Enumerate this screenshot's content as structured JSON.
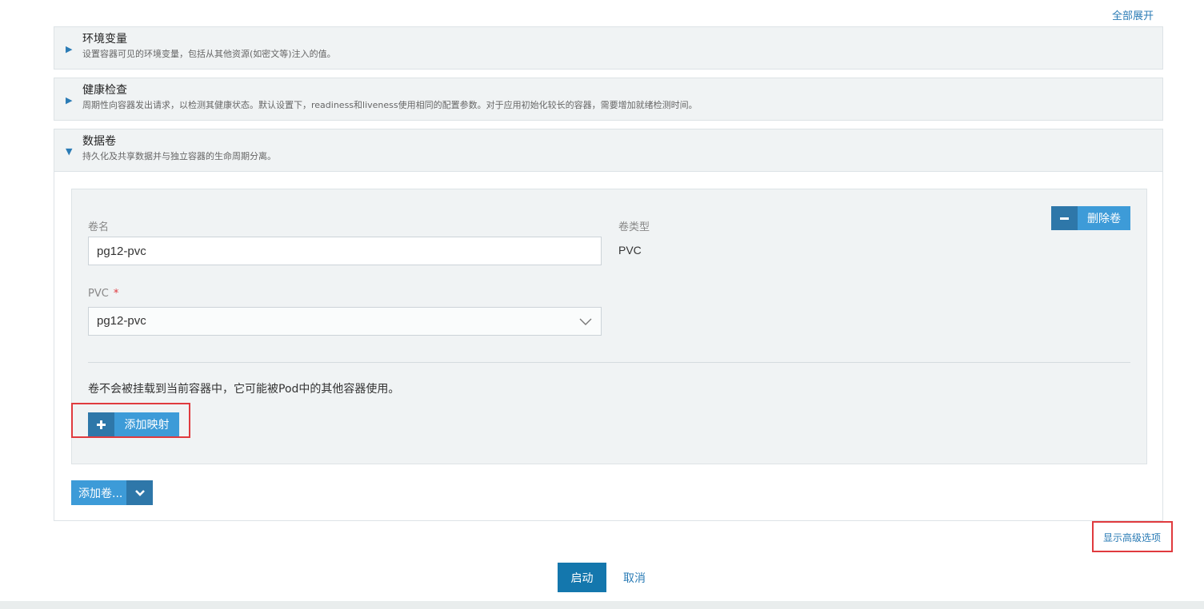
{
  "header": {
    "expand_all": "全部展开"
  },
  "sections": {
    "env": {
      "title": "环境变量",
      "desc": "设置容器可见的环境变量，包括从其他资源(如密文等)注入的值。"
    },
    "health": {
      "title": "健康检查",
      "desc": "周期性向容器发出请求，以检测其健康状态。默认设置下，readiness和liveness使用相同的配置参数。对于应用初始化较长的容器，需要增加就绪检测时间。"
    },
    "volumes": {
      "title": "数据卷",
      "desc": "持久化及共享数据并与独立容器的生命周期分离。"
    }
  },
  "volume_card": {
    "name_label": "卷名",
    "name_value": "pg12-pvc",
    "type_label": "卷类型",
    "type_value": "PVC",
    "pvc_label": "PVC",
    "pvc_required": "*",
    "pvc_value": "pg12-pvc",
    "delete_label": "删除卷",
    "hint": "卷不会被挂载到当前容器中，它可能被Pod中的其他容器使用。",
    "add_mapping_label": "添加映射"
  },
  "add_volume_label": "添加卷...",
  "advanced_link": "显示高级选项",
  "actions": {
    "start": "启动",
    "cancel": "取消"
  },
  "icons": {
    "collapsed": "triangle-right-icon",
    "expanded": "triangle-down-icon",
    "select": "chevron-down-icon",
    "delete": "minus-icon",
    "add": "plus-icon"
  },
  "colors": {
    "accent": "#3d9bd8",
    "accent_dark": "#2e77a9",
    "primary_button": "#1477ad",
    "link": "#2a7bb5",
    "highlight_box": "#e03a3e",
    "required": "#e0393e"
  }
}
